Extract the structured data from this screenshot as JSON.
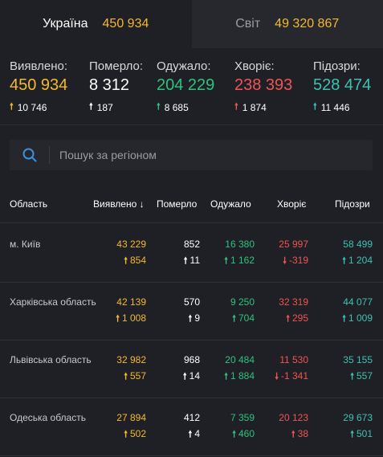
{
  "tabs": [
    {
      "name": "Україна",
      "value": "450 934",
      "active": true
    },
    {
      "name": "Світ",
      "value": "49 320 867",
      "active": false
    }
  ],
  "summary": [
    {
      "label": "Виявлено:",
      "value": "450 934",
      "delta": "10 746",
      "color": "#f5b82e",
      "arrow": "up"
    },
    {
      "label": "Померло:",
      "value": "8 312",
      "delta": "187",
      "color": "#ffffff",
      "arrow": "up"
    },
    {
      "label": "Одужало:",
      "value": "204 229",
      "delta": "8 685",
      "color": "#2ec27e",
      "arrow": "up"
    },
    {
      "label": "Хворіє:",
      "value": "238 393",
      "delta": "1 874",
      "color": "#f05454",
      "arrow": "up"
    },
    {
      "label": "Підозри:",
      "value": "528 474",
      "delta": "11 446",
      "color": "#3ec1b3",
      "arrow": "up"
    }
  ],
  "search": {
    "placeholder": "Пошук за регіоном",
    "icon": "search-icon"
  },
  "table": {
    "headers": [
      "Область",
      "Виявлено ↓",
      "Померло",
      "Одужало",
      "Хворіє",
      "Підозри"
    ],
    "rows": [
      {
        "region": "м. Київ",
        "confirmed": "43 229",
        "confirmed_d": "854",
        "deaths": "852",
        "deaths_d": "11",
        "recovered": "16 380",
        "recovered_d": "1 162",
        "active": "25 997",
        "active_d": "-319",
        "active_dir": "down",
        "suspected": "58 499",
        "suspected_d": "1 204"
      },
      {
        "region": "Харківська область",
        "confirmed": "42 139",
        "confirmed_d": "1 008",
        "deaths": "570",
        "deaths_d": "9",
        "recovered": "9 250",
        "recovered_d": "704",
        "active": "32 319",
        "active_d": "295",
        "active_dir": "up",
        "suspected": "44 077",
        "suspected_d": "1 009"
      },
      {
        "region": "Львівська область",
        "confirmed": "32 982",
        "confirmed_d": "557",
        "deaths": "968",
        "deaths_d": "14",
        "recovered": "20 484",
        "recovered_d": "1 884",
        "active": "11 530",
        "active_d": "-1 341",
        "active_dir": "down",
        "suspected": "35 155",
        "suspected_d": "557"
      },
      {
        "region": "Одеська область",
        "confirmed": "27 894",
        "confirmed_d": "502",
        "deaths": "412",
        "deaths_d": "4",
        "recovered": "7 359",
        "recovered_d": "460",
        "active": "20 123",
        "active_d": "38",
        "active_dir": "up",
        "suspected": "29 673",
        "suspected_d": "501"
      }
    ]
  },
  "colors": {
    "confirmed": "#f5b82e",
    "deaths": "#ffffff",
    "recovered": "#2ec27e",
    "active": "#f05454",
    "suspected": "#3ec1b3",
    "search_icon": "#3a8fe0"
  }
}
